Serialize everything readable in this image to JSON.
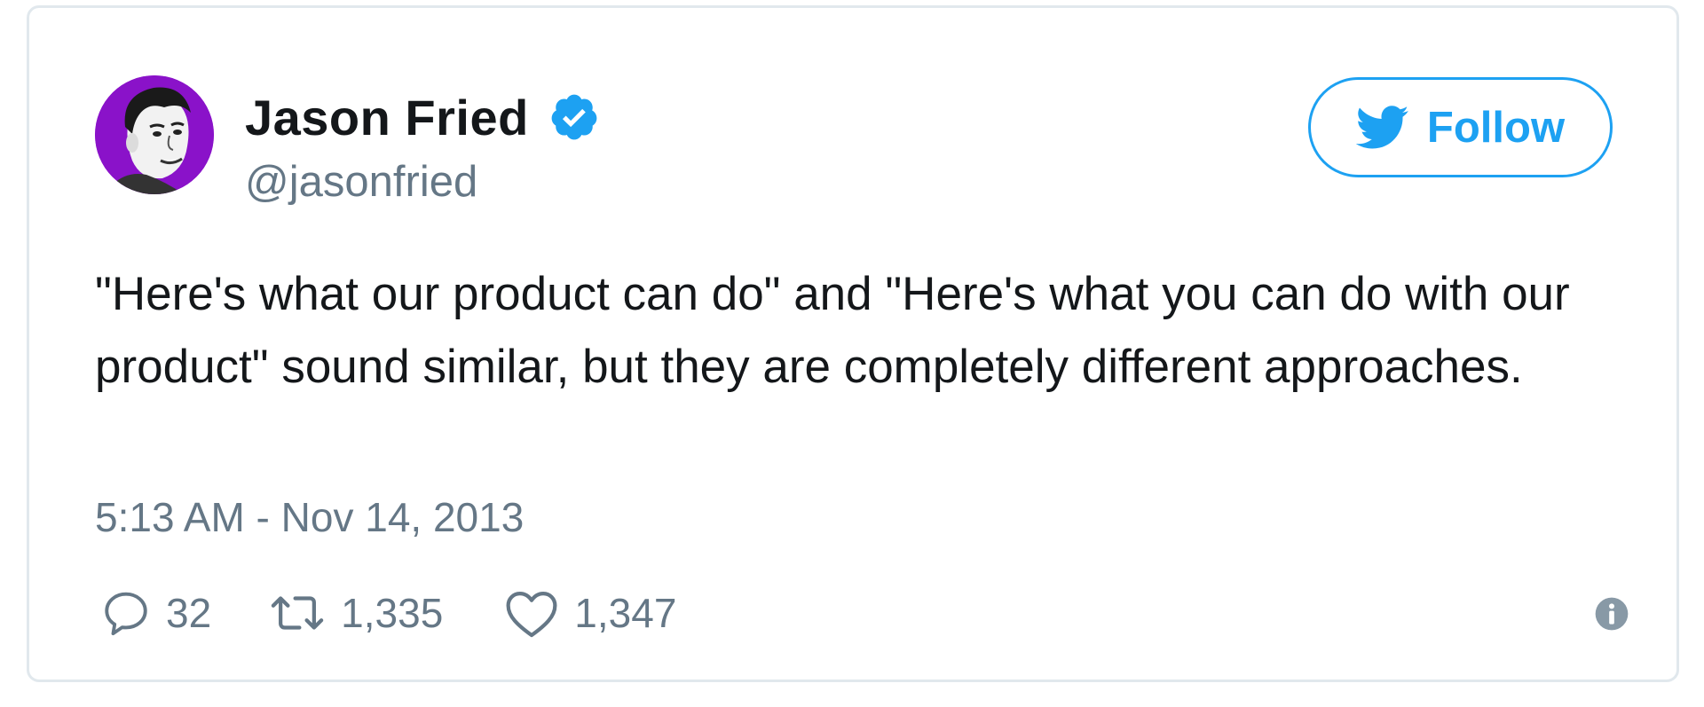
{
  "tweet": {
    "author": {
      "display_name": "Jason Fried",
      "handle": "@jasonfried",
      "verified": true,
      "avatar_color": "#8a12c9"
    },
    "follow_button": {
      "label": "Follow",
      "icon": "twitter-bird-icon"
    },
    "text": "\"Here's what our product can do\" and \"Here's what you can do with our product\" sound similar, but they are completely different approaches.",
    "timestamp": "5:13 AM - Nov 14, 2013",
    "actions": {
      "reply": {
        "icon": "reply-icon",
        "count": "32"
      },
      "retweet": {
        "icon": "retweet-icon",
        "count": "1,335"
      },
      "like": {
        "icon": "heart-icon",
        "count": "1,347"
      }
    },
    "info_icon": "info-icon"
  },
  "colors": {
    "brand_blue": "#1da1f2",
    "verified_blue": "#1da1f2",
    "text_primary": "#14171a",
    "text_secondary": "#657786",
    "border": "#e1e8ed"
  }
}
